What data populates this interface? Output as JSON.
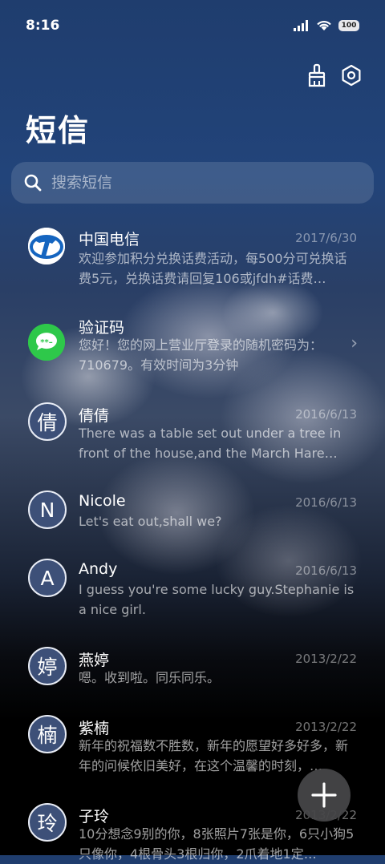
{
  "status_bar": {
    "time": "8:16",
    "battery": "100"
  },
  "header": {
    "title": "短信"
  },
  "search": {
    "placeholder": "搜索短信"
  },
  "conversations": [
    {
      "name": "中国电信",
      "date": "2017/6/30",
      "preview": "欢迎参加积分兑换话费活动，每500分可兑换话费5元，兑换话费请回复106或jfdh#话费…",
      "avatar_icon": "china-telecom-logo"
    },
    {
      "name": "验证码",
      "date": "",
      "preview": "您好！您的网上营业厅登录的随机密码为：710679。有效时间为3分钟",
      "avatar_icon": "verification-code-icon"
    },
    {
      "name": "倩倩",
      "date": "2016/6/13",
      "preview": "There was a table set out under a tree in front of the house,and the March Hare an…",
      "avatar": "倩"
    },
    {
      "name": "Nicole",
      "date": "2016/6/13",
      "preview": "Let's eat out,shall we?",
      "avatar": "N"
    },
    {
      "name": "Andy",
      "date": "2016/6/13",
      "preview": "I guess you're some lucky guy.Stephanie is a nice girl.",
      "avatar": "A"
    },
    {
      "name": "燕婷",
      "date": "2013/2/22",
      "preview": "嗯。收到啦。同乐同乐。",
      "avatar": "婷"
    },
    {
      "name": "紫楠",
      "date": "2013/2/22",
      "preview": "新年的祝福数不胜数，新年的愿望好多好多，新年的问候依旧美好，在这个温馨的时刻，…",
      "avatar": "楠"
    },
    {
      "name": "子玲",
      "date": "2013/2/22",
      "preview": "10分想念9别的你，8张照片7张是你，6只小狗5只像你，4根骨头3根归你，2爪着地1定…",
      "avatar": "玲"
    }
  ],
  "colors": {
    "telecom_blue": "#1565c0",
    "code_green": "#2ec84a",
    "avatar_bg": "#3d5078"
  }
}
